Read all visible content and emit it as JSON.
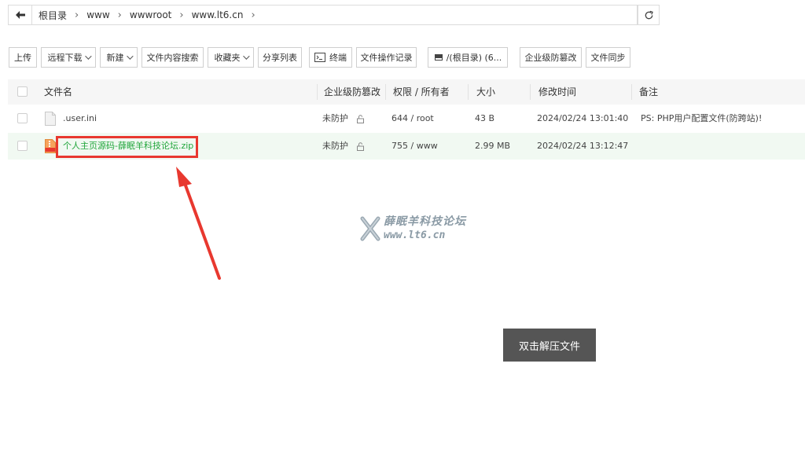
{
  "breadcrumb": {
    "items": [
      "根目录",
      "www",
      "wwwroot",
      "www.lt6.cn"
    ]
  },
  "toolbar": {
    "upload": "上传",
    "remote_download": "远程下载",
    "new": "新建",
    "content_search": "文件内容搜索",
    "favorites": "收藏夹",
    "share_list": "分享列表",
    "terminal": "终端",
    "operation_log": "文件操作记录",
    "disk": "/(根目录) (6...",
    "tamper_protect": "企业级防篡改",
    "file_sync": "文件同步"
  },
  "table": {
    "headers": {
      "name": "文件名",
      "tamper": "企业级防篡改",
      "perm": "权限 / 所有者",
      "size": "大小",
      "mtime": "修改时间",
      "note": "备注"
    },
    "rows": [
      {
        "name": ".user.ini",
        "tamper": "未防护",
        "perm": "644 / root",
        "size": "43 B",
        "mtime": "2024/02/24 13:01:40",
        "note": "PS: PHP用户配置文件(防跨站)!"
      },
      {
        "name": "个人主页源码-薛眠羊科技论坛.zip",
        "tamper": "未防护",
        "perm": "755 / www",
        "size": "2.99 MB",
        "mtime": "2024/02/24 13:12:47",
        "note": ""
      }
    ]
  },
  "watermark": {
    "line1": "薛眠羊科技论坛",
    "line2": "www.lt6.cn"
  },
  "tooltip": "双击解压文件",
  "colors": {
    "accent_green": "#20a53a",
    "highlight_red": "#e8382f",
    "tooltip_bg": "#555555"
  },
  "icons": {
    "back": "arrow-left-icon",
    "refresh": "refresh-icon",
    "file": "file-icon",
    "zip": "zip-file-icon",
    "lock": "lock-open-icon",
    "terminal": "terminal-icon",
    "disk": "disk-icon"
  }
}
